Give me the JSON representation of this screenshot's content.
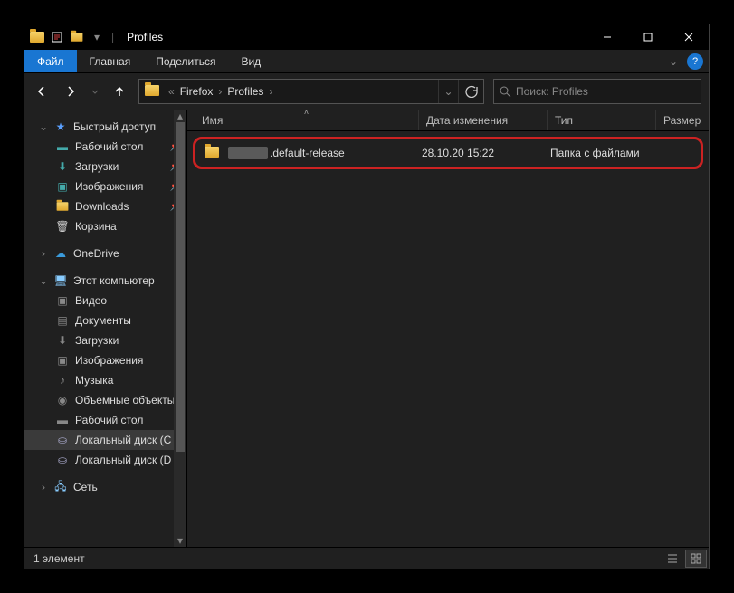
{
  "window": {
    "title": "Profiles"
  },
  "ribbon": {
    "file": "Файл",
    "tabs": [
      "Главная",
      "Поделиться",
      "Вид"
    ]
  },
  "breadcrumbs": [
    "Firefox",
    "Profiles"
  ],
  "address": {
    "refresh_tooltip": "Обновить"
  },
  "search": {
    "placeholder": "Поиск: Profiles"
  },
  "columns": {
    "name": "Имя",
    "date": "Дата изменения",
    "type": "Тип",
    "size": "Размер"
  },
  "files": [
    {
      "name": ".default-release",
      "date": "28.10.20 15:22",
      "type": "Папка с файлами"
    }
  ],
  "sidebar": {
    "quick": "Быстрый доступ",
    "quick_items": [
      "Рабочий стол",
      "Загрузки",
      "Изображения",
      "Downloads",
      "Корзина"
    ],
    "onedrive": "OneDrive",
    "thispc": "Этот компьютер",
    "pc_items": [
      "Видео",
      "Документы",
      "Загрузки",
      "Изображения",
      "Музыка",
      "Объемные объекты",
      "Рабочий стол",
      "Локальный диск (C",
      "Локальный диск (D"
    ],
    "network": "Сеть"
  },
  "status": {
    "count": "1 элемент"
  }
}
